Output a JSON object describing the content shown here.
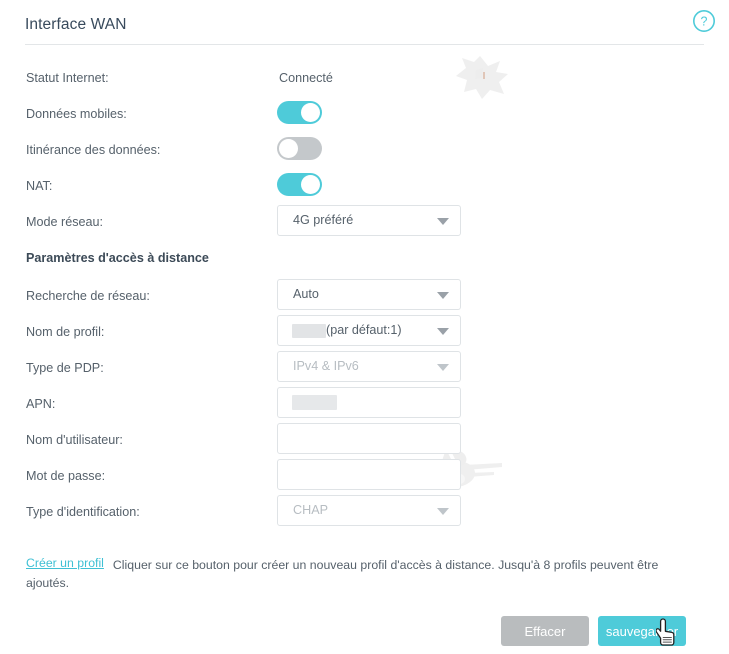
{
  "header": {
    "title": "Interface WAN",
    "help_icon": "question-circle-icon"
  },
  "colors": {
    "accent": "#4ecbd9",
    "link": "#3fc0d4",
    "toggle_on": "#4ecbd9",
    "toggle_off": "#c4c8cb",
    "button_clear": "#b9bcbe",
    "button_save": "#4ecbd9",
    "text": "#56616b",
    "disabled_text": "#b7bdc2",
    "border": "#dfe3e6"
  },
  "form": {
    "internet_status": {
      "label": "Statut Internet:",
      "value": "Connecté"
    },
    "mobile_data": {
      "label": "Données mobiles:",
      "state": "on"
    },
    "data_roaming": {
      "label": "Itinérance des données:",
      "state": "off"
    },
    "nat": {
      "label": "NAT:",
      "state": "on"
    },
    "network_mode": {
      "label": "Mode réseau:",
      "value": "4G préféré",
      "disabled": false
    },
    "section_title": "Paramètres d'accès à distance",
    "network_search": {
      "label": "Recherche de réseau:",
      "value": "Auto",
      "disabled": false
    },
    "profile_name": {
      "label": "Nom de profil:",
      "value_redacted": true,
      "value_suffix": "(par défaut:1)",
      "disabled": false
    },
    "pdp_type": {
      "label": "Type de PDP:",
      "value": "IPv4 & IPv6",
      "disabled": true
    },
    "apn": {
      "label": "APN:",
      "value_redacted": true,
      "value": "",
      "placeholder": ""
    },
    "username": {
      "label": "Nom d'utilisateur:",
      "value": "",
      "placeholder": ""
    },
    "password": {
      "label": "Mot de passe:",
      "value": "",
      "placeholder": ""
    },
    "auth_type": {
      "label": "Type d'identification:",
      "value": "CHAP",
      "disabled": true
    }
  },
  "footer": {
    "create_profile_link": "Créer un profil",
    "note": "Cliquer sur ce bouton pour créer un nouveau profil d'accès à distance. Jusqu'à 8 profils peuvent être ajoutés."
  },
  "actions": {
    "clear_label": "Effacer",
    "save_label": "sauvegarder"
  },
  "cursor": {
    "icon": "pointing-hand-cursor"
  }
}
